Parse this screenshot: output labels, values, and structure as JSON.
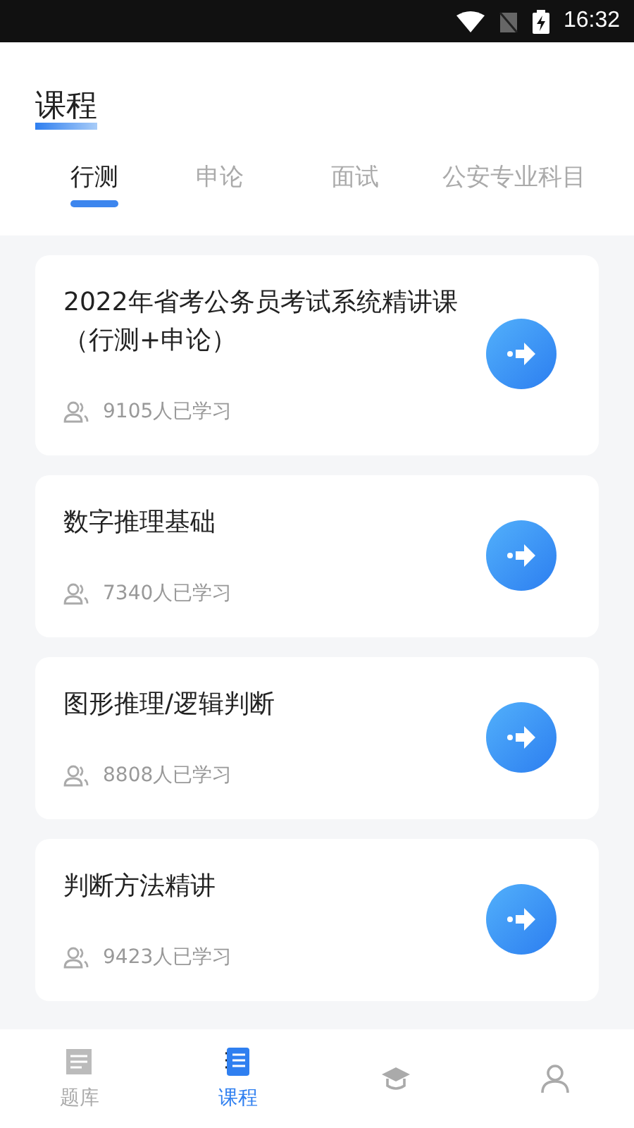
{
  "status_bar": {
    "time": "16:32"
  },
  "header": {
    "title": "课程"
  },
  "tabs": [
    {
      "label": "行测",
      "selected": true
    },
    {
      "label": "申论",
      "selected": false
    },
    {
      "label": "面试",
      "selected": false
    },
    {
      "label": "公安专业科目",
      "selected": false
    }
  ],
  "courses": [
    {
      "title": "2022年省考公务员考试系统精讲课（行测+申论）",
      "learners": "9105人已学习"
    },
    {
      "title": "数字推理基础",
      "learners": "7340人已学习"
    },
    {
      "title": "图形推理/逻辑判断",
      "learners": "8808人已学习"
    },
    {
      "title": "判断方法精讲",
      "learners": "9423人已学习"
    }
  ],
  "bottom_nav": [
    {
      "kind": "bank",
      "label": "题库",
      "selected": false
    },
    {
      "kind": "course",
      "label": "课程",
      "selected": true
    },
    {
      "kind": "cap",
      "selected": false
    },
    {
      "kind": "profile",
      "selected": false
    }
  ]
}
